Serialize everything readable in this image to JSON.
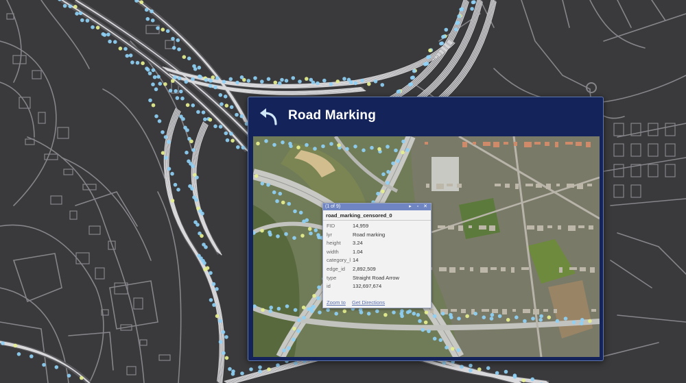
{
  "panel": {
    "title": "Road Marking",
    "back_icon": "back-arrow-icon"
  },
  "popup": {
    "counter": "(1 of 9)",
    "layer_name": "road_marking_censored_0",
    "controls": [
      "next-icon",
      "maximize-icon",
      "close-icon"
    ],
    "fields": [
      {
        "key": "FID",
        "value": "14,959"
      },
      {
        "key": "lyr",
        "value": "Road marking"
      },
      {
        "key": "height",
        "value": "3.24"
      },
      {
        "key": "width",
        "value": "1.04"
      },
      {
        "key": "category_l",
        "value": "14"
      },
      {
        "key": "edge_id",
        "value": "2,892,509"
      },
      {
        "key": "type",
        "value": "Straight Road Arrow"
      },
      {
        "key": "id",
        "value": "132,697,674"
      }
    ],
    "links": {
      "zoom": "Zoom to",
      "directions": "Get Directions"
    }
  },
  "colors": {
    "basemap": "#3a3a3c",
    "road_lines": "#8a8a8e",
    "highway": "#e8e8ea",
    "marker_blue": "#8fd0f5",
    "marker_yellow": "#e6ef8f",
    "panel_bg": "#14235a",
    "popup_bar": "#6f86c2"
  }
}
